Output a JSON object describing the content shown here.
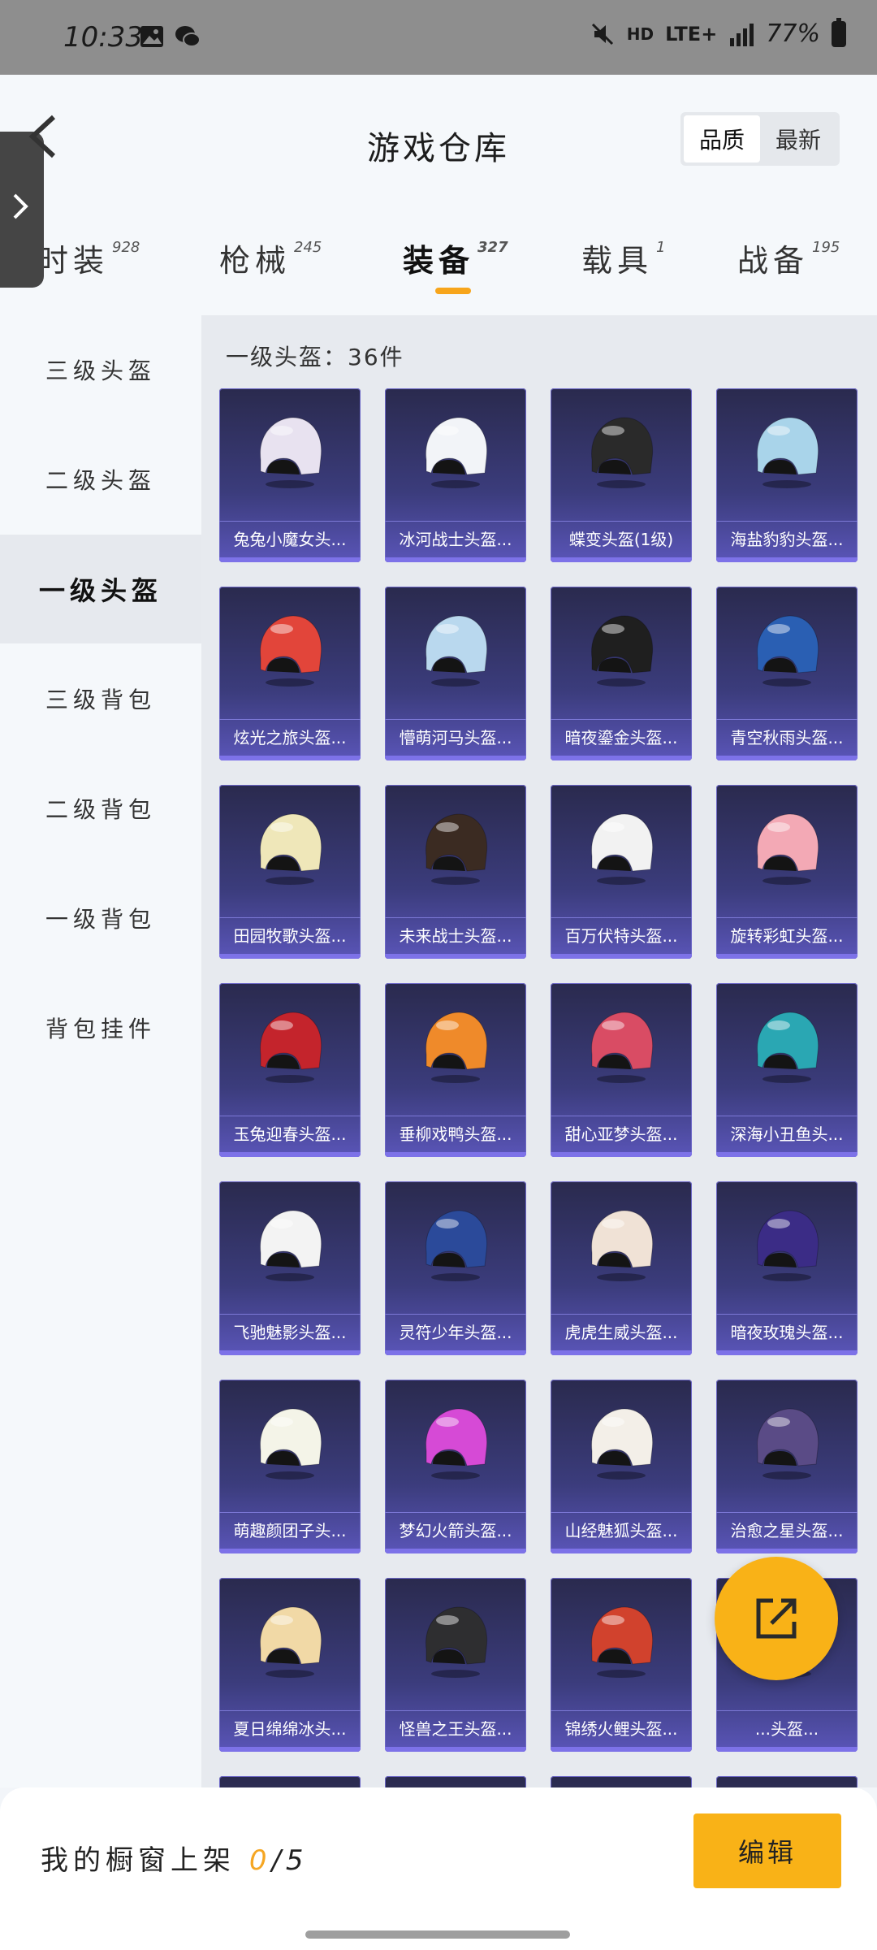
{
  "status_bar": {
    "time": "10:33",
    "hd": "HD",
    "network": "LTE+",
    "battery": "77%"
  },
  "header": {
    "title": "游戏仓库",
    "sort_options": [
      {
        "label": "品质",
        "active": true
      },
      {
        "label": "最新",
        "active": false
      }
    ]
  },
  "category_tabs": [
    {
      "label": "时装",
      "count": "928",
      "active": false
    },
    {
      "label": "枪械",
      "count": "245",
      "active": false
    },
    {
      "label": "装备",
      "count": "327",
      "active": true
    },
    {
      "label": "载具",
      "count": "1",
      "active": false
    },
    {
      "label": "战备",
      "count": "195",
      "active": false
    }
  ],
  "sidebar": {
    "items": [
      {
        "label": "三级头盔",
        "active": false
      },
      {
        "label": "二级头盔",
        "active": false
      },
      {
        "label": "一级头盔",
        "active": true
      },
      {
        "label": "三级背包",
        "active": false
      },
      {
        "label": "二级背包",
        "active": false
      },
      {
        "label": "一级背包",
        "active": false
      },
      {
        "label": "背包挂件",
        "active": false
      }
    ]
  },
  "main": {
    "count_label": "一级头盔：36件",
    "items": [
      {
        "name": "兔兔小魔女头...",
        "color": "#e8e2f0"
      },
      {
        "name": "冰河战士头盔...",
        "color": "#f2f4f8"
      },
      {
        "name": "蝶变头盔(1级)",
        "color": "#2a2a2a"
      },
      {
        "name": "海盐豹豹头盔...",
        "color": "#a9d4ea"
      },
      {
        "name": "炫光之旅头盔...",
        "color": "#e2453a"
      },
      {
        "name": "懵萌河马头盔...",
        "color": "#b9d8ee"
      },
      {
        "name": "暗夜鎏金头盔...",
        "color": "#1f1f1f"
      },
      {
        "name": "青空秋雨头盔...",
        "color": "#2a5fb3"
      },
      {
        "name": "田园牧歌头盔...",
        "color": "#efe7b9"
      },
      {
        "name": "未来战士头盔...",
        "color": "#3b2b22"
      },
      {
        "name": "百万伏特头盔...",
        "color": "#f2f2f2"
      },
      {
        "name": "旋转彩虹头盔...",
        "color": "#f3a9b5"
      },
      {
        "name": "玉兔迎春头盔...",
        "color": "#c4242c"
      },
      {
        "name": "垂柳戏鸭头盔...",
        "color": "#ef8a2a"
      },
      {
        "name": "甜心亚梦头盔...",
        "color": "#d94c64"
      },
      {
        "name": "深海小丑鱼头...",
        "color": "#2aa7b3"
      },
      {
        "name": "飞驰魅影头盔...",
        "color": "#f3f3f3"
      },
      {
        "name": "灵符少年头盔...",
        "color": "#2b4a9a"
      },
      {
        "name": "虎虎生威头盔...",
        "color": "#f0e2d6"
      },
      {
        "name": "暗夜玫瑰头盔...",
        "color": "#3b2c86"
      },
      {
        "name": "萌趣颜团子头...",
        "color": "#f4f4e8"
      },
      {
        "name": "梦幻火箭头盔...",
        "color": "#d64ad6"
      },
      {
        "name": "山经魅狐头盔...",
        "color": "#f3efe8"
      },
      {
        "name": "治愈之星头盔...",
        "color": "#5a4b86"
      },
      {
        "name": "夏日绵绵冰头...",
        "color": "#f1d9a6"
      },
      {
        "name": "怪兽之王头盔...",
        "color": "#2e2e30"
      },
      {
        "name": "锦绣火鲤头盔...",
        "color": "#d1422d"
      },
      {
        "name": "...头盔...",
        "color": "#e3d4f0"
      }
    ]
  },
  "bottom_bar": {
    "shelf_label": "我的橱窗上架",
    "shelf_count": "0",
    "shelf_total": "/5",
    "edit_label": "编辑"
  }
}
